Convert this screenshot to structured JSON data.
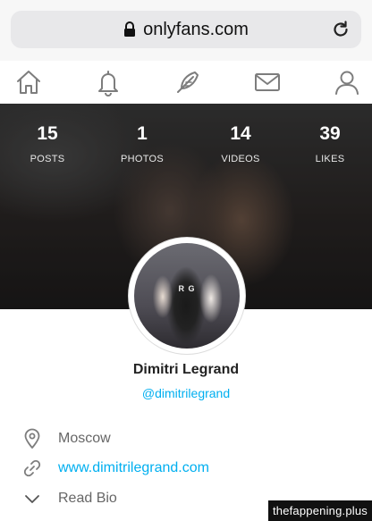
{
  "browser": {
    "url": "onlyfans.com"
  },
  "nav": {
    "items": [
      "home-icon",
      "bell-icon",
      "feather-icon",
      "mail-icon",
      "user-icon"
    ]
  },
  "stats": [
    {
      "value": "15",
      "label": "POSTS"
    },
    {
      "value": "1",
      "label": "PHOTOS"
    },
    {
      "value": "14",
      "label": "VIDEOS"
    },
    {
      "value": "39",
      "label": "LIKES"
    }
  ],
  "profile": {
    "avatar_text": "R G",
    "name": "Dimitri Legrand",
    "handle": "@dimitrilegrand"
  },
  "info": {
    "location": "Moscow",
    "website": "www.dimitrilegrand.com",
    "read_bio": "Read Bio"
  },
  "watermark": "thefappening.plus",
  "colors": {
    "accent": "#00aff0",
    "icon": "#7d7d7d"
  }
}
